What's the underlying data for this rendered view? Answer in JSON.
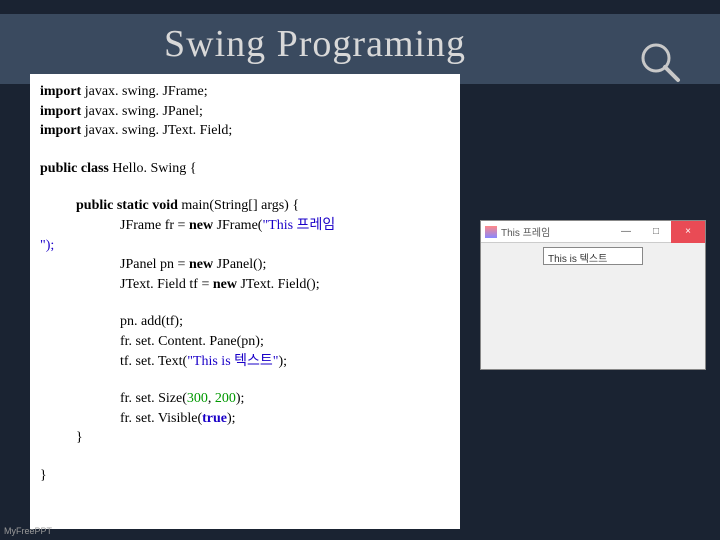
{
  "title": "Swing Programing",
  "code": {
    "l1a": "import",
    "l1b": " javax. swing. JFrame;",
    "l2a": "import",
    "l2b": " javax. swing. JPanel;",
    "l3a": "import",
    "l3b": " javax. swing. JText. Field;",
    "l4a": "public class",
    "l4b": " Hello. Swing {",
    "l5a": "public static void",
    "l5b": " main(String[] args) {",
    "l6a": "JFrame fr = ",
    "l6b": "new",
    "l6c": " JFrame(",
    "l6d": "\"This 프레임",
    "l6e": "",
    "l7": "\");",
    "l8a": "JPanel pn = ",
    "l8b": "new",
    "l8c": " JPanel();",
    "l9a": "JText. Field tf = ",
    "l9b": "new",
    "l9c": " JText. Field();",
    "l10": "pn. add(tf);",
    "l11": "fr. set. Content. Pane(pn);",
    "l12a": "tf. set. Text(",
    "l12b": "\"This is 텍스트\"",
    "l12c": ");",
    "l13a": "fr. set. Size(",
    "l13b": "300",
    "l13c": ", ",
    "l13d": "200",
    "l13e": ");",
    "l14a": "fr. set. Visible(",
    "l14b": "true",
    "l14c": ");",
    "l15": "}",
    "l16": "}"
  },
  "mock_window": {
    "title": "This 프레임",
    "textfield_value": "This is 텍스트",
    "minimize": "—",
    "maximize": "□",
    "close": "×"
  },
  "footer": "MyFreePPT"
}
